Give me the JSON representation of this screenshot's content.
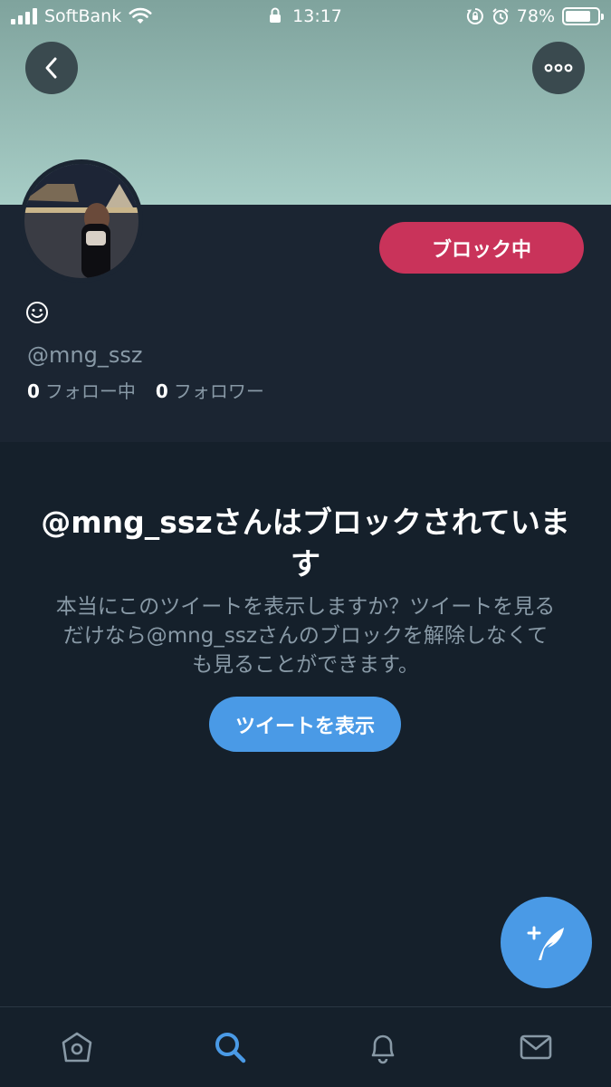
{
  "status_bar": {
    "carrier": "SoftBank",
    "time": "13:17",
    "battery_percent": "78%",
    "battery_level": 0.78
  },
  "header": {
    "back_icon": "chevron-left-icon",
    "more_icon": "more-horizontal-icon"
  },
  "profile": {
    "display_name_emoji": "smiley-emoji",
    "handle": "@mng_ssz",
    "following_count": "0",
    "following_label": "フォロー中",
    "followers_count": "0",
    "followers_label": "フォロワー",
    "block_button_label": "ブロック中"
  },
  "notice": {
    "title": "@mng_sszさんはブロックされています",
    "text": "本当にこのツイートを表示しますか？ツイートを見るだけなら@mng_sszさんのブロックを解除しなくても見ることができます。",
    "show_button_label": "ツイートを表示"
  },
  "fab": {
    "icon": "compose-tweet-icon"
  },
  "tabbar": {
    "items": [
      {
        "name": "home",
        "icon": "home-icon",
        "active": false
      },
      {
        "name": "search",
        "icon": "search-icon",
        "active": true
      },
      {
        "name": "notifications",
        "icon": "bell-icon",
        "active": false
      },
      {
        "name": "messages",
        "icon": "mail-icon",
        "active": false
      }
    ]
  },
  "colors": {
    "background": "#15202b",
    "profile_background": "#1b2532",
    "accent_blue": "#4a9ae6",
    "block_red": "#c9335a",
    "secondary_text": "#8899a6"
  }
}
